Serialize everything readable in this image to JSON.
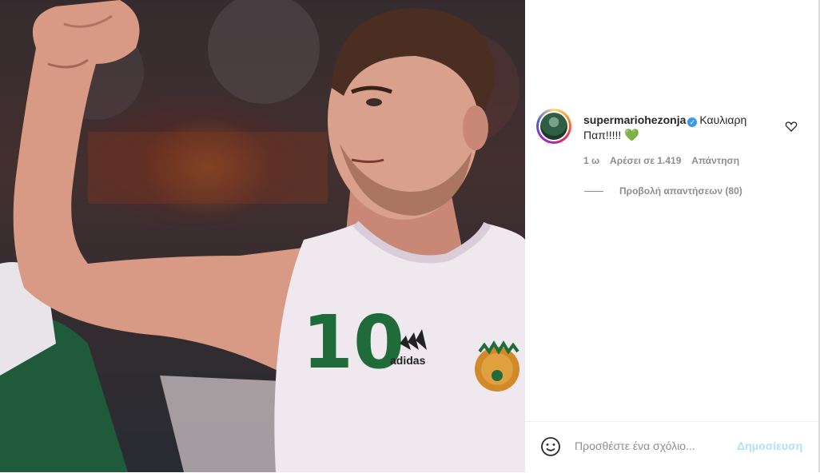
{
  "post": {
    "jersey_number": "10",
    "jersey_brand": "adidas"
  },
  "comment": {
    "username": "supermariohezonja",
    "text": "Καυλιαρη Παπ!!!!!",
    "emoji": "💚",
    "time": "1 ω",
    "likes": "Αρέσει σε 1.419",
    "reply_label": "Απάντηση",
    "view_replies": "Προβολή απαντήσεων (80)"
  },
  "composer": {
    "placeholder": "Προσθέστε ένα σχόλιο...",
    "post_label": "Δημοσίευση"
  },
  "icons": {
    "verified": "verified-badge-icon",
    "like": "heart-outline-icon",
    "emoji": "smiley-icon"
  },
  "colors": {
    "verified": "#3897f0",
    "post_disabled": "#b2dffc",
    "jersey_green": "#1f6b3a"
  }
}
